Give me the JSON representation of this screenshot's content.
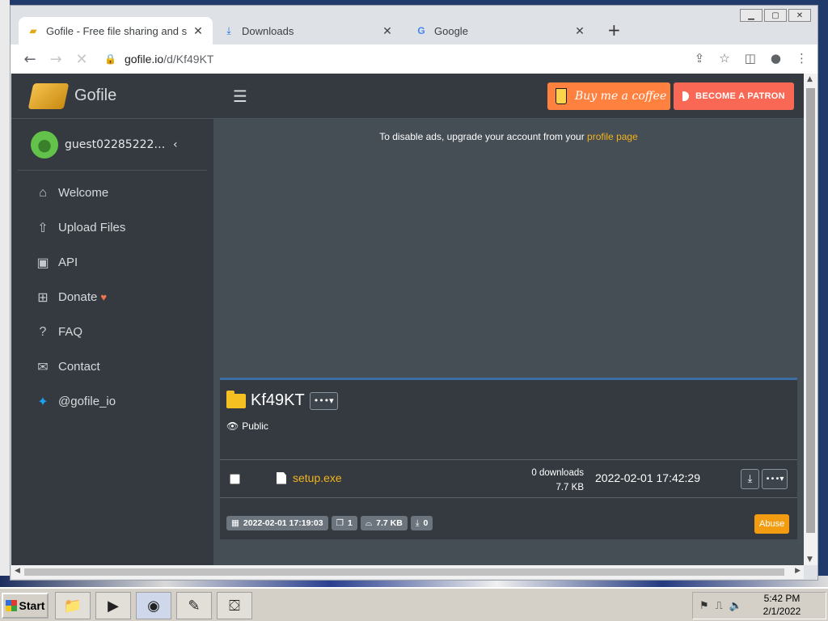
{
  "tabs": [
    {
      "title": "Gofile - Free file sharing and s",
      "icon": "gofile-favicon",
      "active": true
    },
    {
      "title": "Downloads",
      "icon": "download-icon",
      "active": false
    },
    {
      "title": "Google",
      "icon": "google-icon",
      "active": false
    }
  ],
  "address": {
    "host": "gofile.io",
    "path": "/d/Kf49KT"
  },
  "sidebar": {
    "brand": "Gofile",
    "username": "guest022852229...",
    "items": [
      {
        "label": "Welcome",
        "icon": "home-icon"
      },
      {
        "label": "Upload Files",
        "icon": "upload-file-icon"
      },
      {
        "label": "API",
        "icon": "laptop-code-icon"
      },
      {
        "label": "Donate",
        "icon": "gift-icon"
      },
      {
        "label": "FAQ",
        "icon": "question-icon"
      },
      {
        "label": "Contact",
        "icon": "envelope-icon"
      },
      {
        "label": "@gofile_io",
        "icon": "twitter-icon"
      }
    ]
  },
  "header": {
    "bmc_label": "Buy me a coffee",
    "patron_label": "BECOME A PATRON"
  },
  "ads": {
    "text": "To disable ads, upgrade your account from your ",
    "link": "profile page"
  },
  "folder": {
    "name": "Kf49KT",
    "visibility": "Public",
    "files": [
      {
        "name": "setup.exe",
        "downloads": "0 downloads",
        "size": "7.7 KB",
        "date": "2022-02-01 17:42:29"
      }
    ],
    "meta": {
      "created": "2022-02-01 17:19:03",
      "count": "1",
      "total_size": "7.7 KB",
      "total_downloads": "0"
    },
    "abuse_label": "Abuse"
  },
  "taskbar": {
    "start_label": "Start",
    "time": "5:42 PM",
    "date": "2/1/2022"
  },
  "colors": {
    "accent": "#f3b41c",
    "sidebar": "#343a40",
    "content": "#454d55",
    "bmc": "#ff813f",
    "patron": "#f96854",
    "abuse": "#f39c12"
  }
}
